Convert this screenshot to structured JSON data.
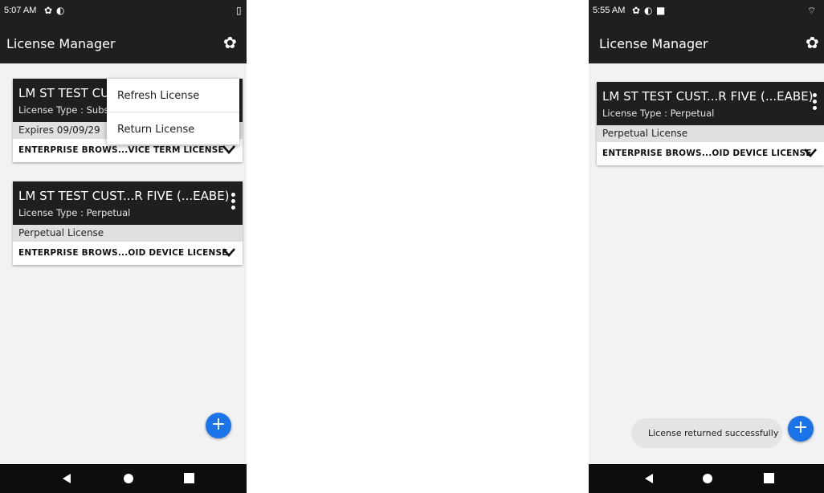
{
  "left_screen": {
    "status": {
      "time": "5:07 AM",
      "icons": [
        "gear-icon",
        "sync-icon",
        "battery-icon"
      ]
    },
    "app_bar": {
      "title": "License Manager"
    },
    "cards": [
      {
        "title": "LM ST TEST CUS",
        "license_type": "License Type : Subs",
        "status": "Expires 09/09/29",
        "product": "ENTERPRISE BROWS...VICE TERM LICENSE"
      },
      {
        "title": "LM ST TEST CUST...R FIVE (...EABE)",
        "license_type": "License Type : Perpetual",
        "status": "Perpetual License",
        "product": "ENTERPRISE BROWS...OID DEVICE LICENSE"
      }
    ],
    "menu": {
      "items": [
        "Refresh License",
        "Return License"
      ]
    },
    "fab": {
      "label": "+"
    }
  },
  "right_screen": {
    "status": {
      "time": "5:55 AM",
      "icons": [
        "gear-icon",
        "sync-icon",
        "square-icon",
        "wifi-icon"
      ]
    },
    "app_bar": {
      "title": "License Manager"
    },
    "cards": [
      {
        "title": "LM ST TEST CUST...R FIVE (...EABE)",
        "license_type": "License Type : Perpetual",
        "status": "Perpetual License",
        "product": "ENTERPRISE BROWS...OID DEVICE LICENSE"
      }
    ],
    "toast": {
      "message": "License returned successfully"
    },
    "fab": {
      "label": "+"
    }
  },
  "colors": {
    "bar": "#1f1f1f",
    "accent": "#1a73e8",
    "status_row": "#e0e0e0",
    "nav": "#0d0d0d"
  }
}
